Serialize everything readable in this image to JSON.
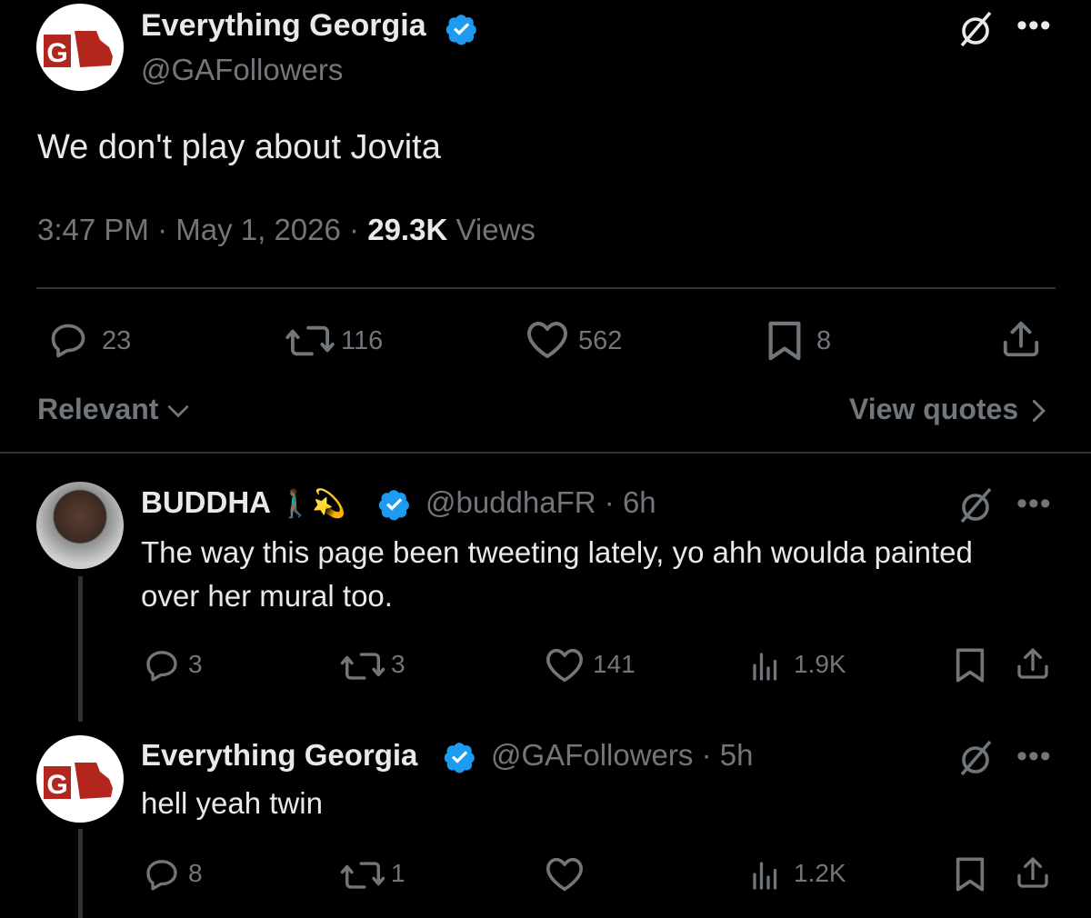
{
  "main_tweet": {
    "display_name": "Everything Georgia",
    "handle": "@GAFollowers",
    "text": "We don't play about Jovita",
    "time": "3:47 PM",
    "date": "May 1, 2026",
    "views_count": "29.3K",
    "views_label": "Views",
    "sep": "·",
    "stats": {
      "replies": "23",
      "reposts": "116",
      "likes": "562",
      "bookmarks": "8"
    },
    "logo_letters": "G"
  },
  "reply_controls": {
    "sort_label": "Relevant",
    "quotes_label": "View quotes"
  },
  "replies": [
    {
      "display_name": "BUDDHA",
      "emoji": "🚶🏾‍♂️💫",
      "handle": "@buddhaFR",
      "age": "6h",
      "text": "The way this page been tweeting lately, yo ahh woulda painted over her mural too.",
      "stats": {
        "replies": "3",
        "reposts": "3",
        "likes": "141",
        "views": "1.9K"
      }
    },
    {
      "display_name": "Everything Georgia",
      "handle": "@GAFollowers",
      "age": "5h",
      "text": "hell yeah twin",
      "stats": {
        "replies": "8",
        "reposts": "1",
        "likes": "",
        "views": "1.2K"
      }
    }
  ],
  "colors": {
    "background": "#000000",
    "text": "#e7e9ea",
    "muted": "#71767b",
    "verified": "#1d9bf0",
    "logo_red": "#b3261e",
    "divider": "#2f3336"
  },
  "icons": [
    "grok-icon",
    "more-icon",
    "reply-icon",
    "repost-icon",
    "like-icon",
    "bookmark-icon",
    "share-icon",
    "views-icon",
    "verified-icon",
    "chevron-down-icon",
    "chevron-right-icon"
  ]
}
